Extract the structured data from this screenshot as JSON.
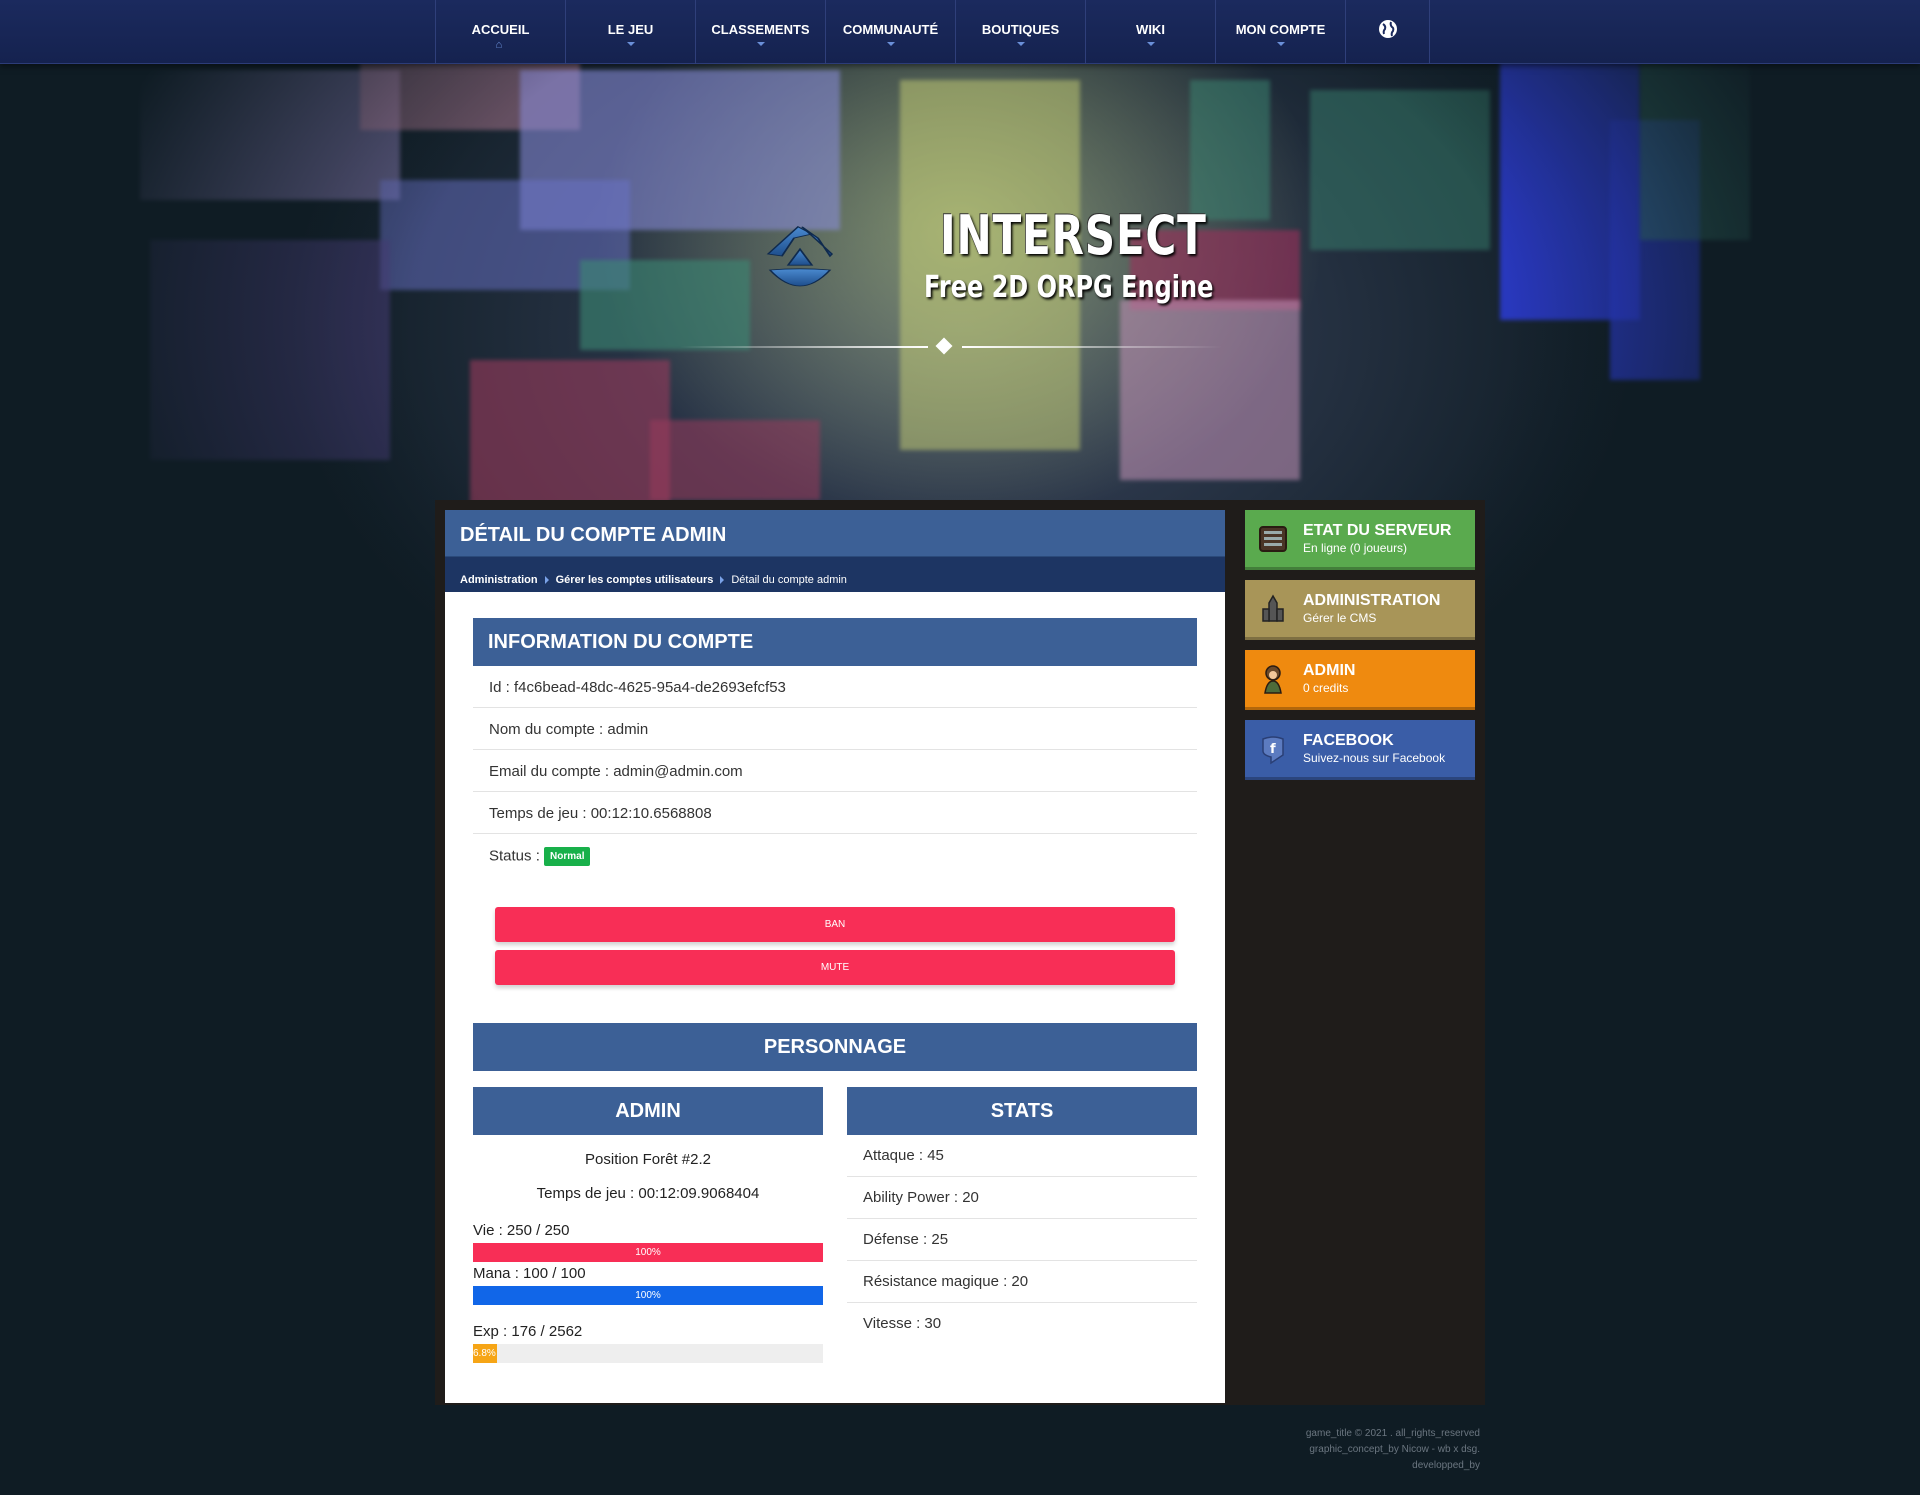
{
  "nav": {
    "items": [
      {
        "label": "ACCUEIL",
        "icon": "home-icon"
      },
      {
        "label": "LE JEU",
        "icon": "chevron-down-icon"
      },
      {
        "label": "CLASSEMENTS",
        "icon": "chevron-down-icon"
      },
      {
        "label": "COMMUNAUTÉ",
        "icon": "chevron-down-icon"
      },
      {
        "label": "BOUTIQUES",
        "icon": "chevron-down-icon"
      },
      {
        "label": "WIKI",
        "icon": "chevron-down-icon"
      },
      {
        "label": "MON COMPTE",
        "icon": "chevron-down-icon"
      }
    ],
    "globe_icon": "globe-icon",
    "accent": "#6a8fd8"
  },
  "hero": {
    "title": "INTERSECT",
    "subtitle": "Free 2D ORPG Engine"
  },
  "page": {
    "title": "DÉTAIL DU COMPTE ADMIN",
    "breadcrumb": [
      "Administration",
      "Gérer les comptes utilisateurs",
      "Détail du compte admin"
    ]
  },
  "account": {
    "heading": "INFORMATION DU COMPTE",
    "id": "Id : f4c6bead-48dc-4625-95a4-de2693efcf53",
    "name": "Nom du compte : admin",
    "email": "Email du compte : admin@admin.com",
    "playtime": "Temps de jeu : 00:12:10.6568808",
    "status_label": "Status :",
    "status_badge": "Normal",
    "status_color": "#18b04a"
  },
  "actions": {
    "ban": "BAN",
    "mute": "MUTE",
    "color": "#f82e56"
  },
  "character": {
    "heading": "PERSONNAGE",
    "name": "ADMIN",
    "position": "Position Forêt #2.2",
    "playtime": "Temps de jeu : 00:12:09.9068404",
    "hp": {
      "label": "Vie : 250 / 250",
      "percent_text": "100%",
      "fraction": 1.0,
      "color": "#f82e56"
    },
    "mana": {
      "label": "Mana : 100 / 100",
      "percent_text": "100%",
      "fraction": 1.0,
      "color": "#1166e8"
    },
    "exp": {
      "label": "Exp : 176 / 2562",
      "percent_text": "6.8%",
      "fraction": 0.068,
      "color": "#f6a516"
    }
  },
  "stats": {
    "heading": "STATS",
    "items": [
      "Attaque : 45",
      "Ability Power : 20",
      "Défense : 25",
      "Résistance magique : 20",
      "Vitesse : 30"
    ]
  },
  "sidebar": {
    "cards": [
      {
        "title": "ETAT DU SERVEUR",
        "subtitle": "En ligne (0 joueurs)",
        "color": "#5aaa4e",
        "icon": "server-icon"
      },
      {
        "title": "ADMINISTRATION",
        "subtitle": "Gérer le CMS",
        "color": "#a89558",
        "icon": "castle-icon"
      },
      {
        "title": "ADMIN",
        "subtitle": "0 credits",
        "color": "#ef8a0f",
        "icon": "character-avatar-icon"
      },
      {
        "title": "FACEBOOK",
        "subtitle": "Suivez-nous sur Facebook",
        "color": "#3a5da7",
        "icon": "facebook-icon"
      }
    ]
  },
  "footer": {
    "line1": "game_title © 2021 . all_rights_reserved",
    "line2": "graphic_concept_by Nicow - wb x dsg.",
    "line3": "developped_by"
  }
}
